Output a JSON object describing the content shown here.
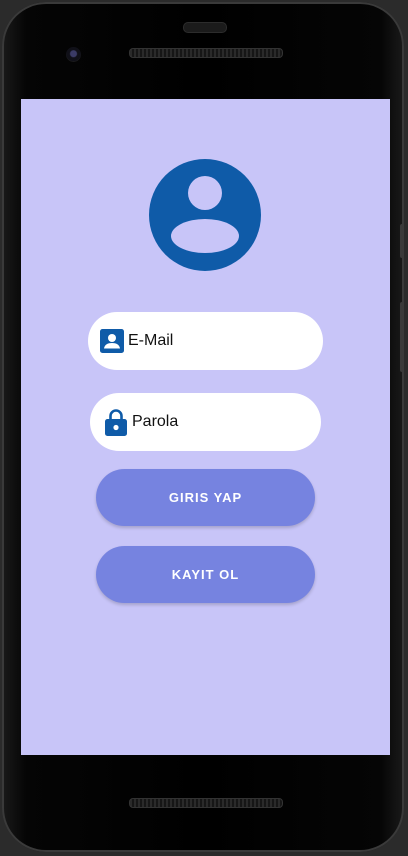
{
  "colors": {
    "screen_background": "#c8c5f8",
    "accent_icon": "#0f5ba8",
    "field_background": "#ffffff",
    "button_background": "#7683e0",
    "button_text": "#ffffff"
  },
  "avatar": {
    "icon": "account-circle-icon"
  },
  "login_form": {
    "email": {
      "placeholder": "E-Mail",
      "value": "",
      "icon": "account-box-icon"
    },
    "password": {
      "placeholder": "Parola",
      "value": "",
      "icon": "lock-icon"
    }
  },
  "buttons": {
    "login_label": "GIRIS YAP",
    "register_label": "KAYIT OL"
  }
}
